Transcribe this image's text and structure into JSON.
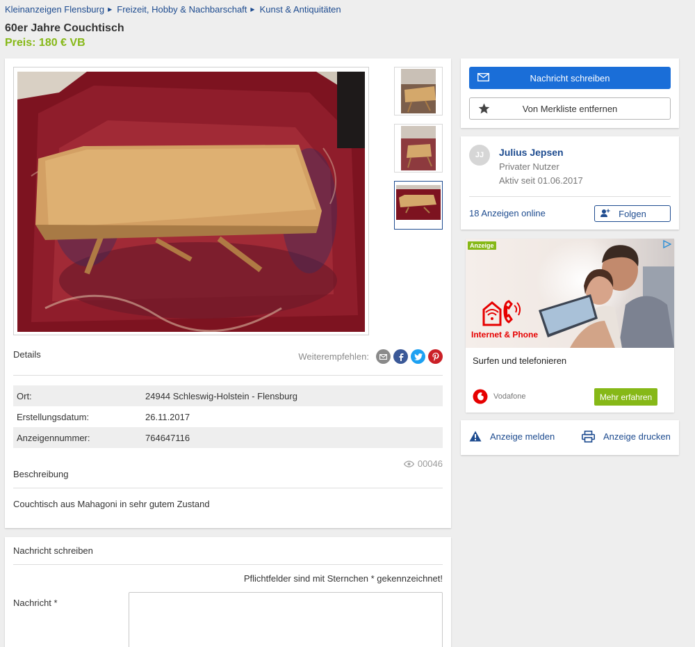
{
  "breadcrumb": [
    {
      "label": "Kleinanzeigen Flensburg"
    },
    {
      "label": "Freizeit, Hobby & Nachbarschaft"
    },
    {
      "label": "Kunst & Antiquitäten"
    }
  ],
  "listing": {
    "title": "60er Jahre Couchtisch",
    "price": "Preis: 180 € VB",
    "gallery_count": 3,
    "selected_thumb": 3
  },
  "details": {
    "heading": "Details",
    "share_label": "Weiterempfehlen:",
    "share_icons": [
      "email-icon",
      "facebook-icon",
      "twitter-icon",
      "pinterest-icon"
    ],
    "rows": [
      {
        "key": "Ort:",
        "value": "24944 Schleswig-Holstein - Flensburg"
      },
      {
        "key": "Erstellungsdatum:",
        "value": "26.11.2017"
      },
      {
        "key": "Anzeigennummer:",
        "value": "764647116"
      }
    ],
    "views": "00046"
  },
  "description": {
    "heading": "Beschreibung",
    "text": "Couchtisch aus Mahagoni in sehr gutem Zustand"
  },
  "message_form": {
    "heading": "Nachricht schreiben",
    "required_note": "Pflichtfelder sind mit Sternchen  * gekennzeichnet!",
    "message_label": "Nachricht *",
    "message_value": ""
  },
  "actions": {
    "write_message": "Nachricht schreiben",
    "remove_watchlist": "Von Merkliste entfernen"
  },
  "seller": {
    "initials": "JJ",
    "name": "Julius Jepsen",
    "type": "Privater Nutzer",
    "active_since": "Aktiv seit 01.06.2017",
    "ads_online": "18 Anzeigen online",
    "follow_label": "Folgen"
  },
  "promo": {
    "badge": "Anzeige",
    "brand_text": "Internet & Phone",
    "headline": "Surfen und telefonieren",
    "advertiser": "Vodafone",
    "cta": "Mehr erfahren"
  },
  "footer_actions": {
    "report": "Anzeige melden",
    "print": "Anzeige drucken"
  },
  "colors": {
    "link_blue": "#1d4b8f",
    "primary_blue": "#1a6ed8",
    "price_green": "#86b817",
    "vodafone_red": "#e60000"
  }
}
